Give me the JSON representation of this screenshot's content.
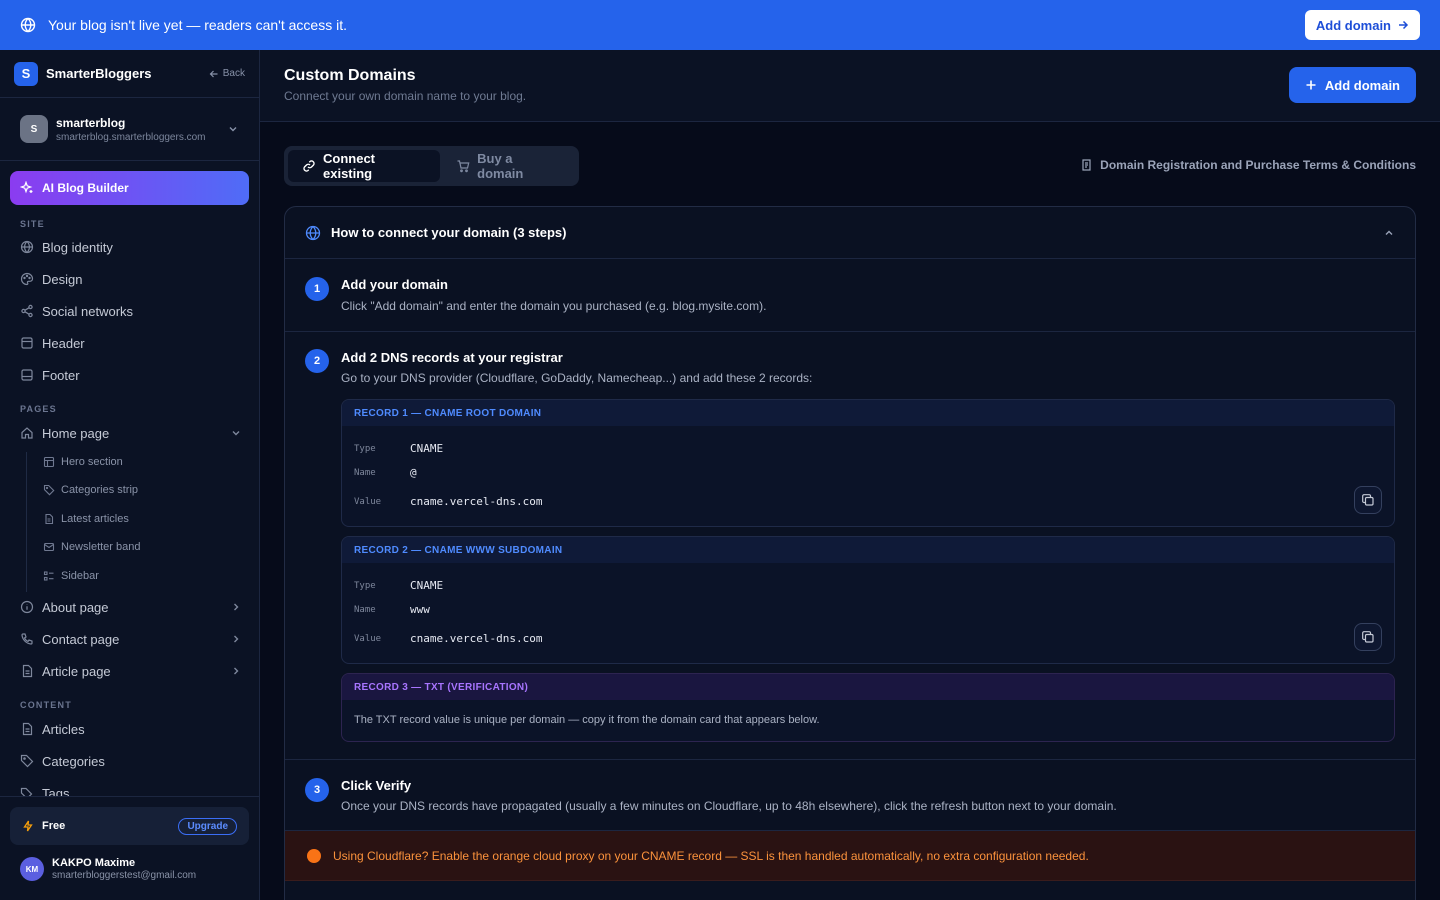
{
  "banner": {
    "message": "Your blog isn't live yet — readers can't access it.",
    "button_label": "Add domain",
    "color": "#2563eb"
  },
  "sidebar": {
    "brand_initial": "S",
    "brand_name": "SmarterBloggers",
    "back_label": "Back",
    "blog": {
      "initial": "S",
      "name": "smarterblog",
      "url": "smarterblog.smarterbloggers.com"
    },
    "ai_button": "AI Blog Builder",
    "sections": {
      "site": "SITE",
      "pages": "PAGES",
      "content": "CONTENT"
    },
    "site_items": [
      "Blog identity",
      "Design",
      "Social networks",
      "Header",
      "Footer"
    ],
    "pages_items": {
      "home": "Home page",
      "home_sub": [
        "Hero section",
        "Categories strip",
        "Latest articles",
        "Newsletter band",
        "Sidebar"
      ],
      "about": "About page",
      "contact": "Contact page",
      "article": "Article page"
    },
    "content_items": [
      "Articles",
      "Categories",
      "Tags"
    ],
    "plan": {
      "name": "Free",
      "upgrade": "Upgrade"
    },
    "user": {
      "initials": "KM",
      "name": "KAKPO Maxime",
      "email": "smarterbloggerstest@gmail.com"
    }
  },
  "main": {
    "title": "Custom Domains",
    "subtitle": "Connect your own domain name to your blog.",
    "add_button": "Add domain",
    "tabs": [
      "Connect existing",
      "Buy a domain"
    ],
    "terms_link": "Domain Registration and Purchase Terms & Conditions",
    "guide": {
      "title": "How to connect your domain (3 steps)",
      "steps": [
        {
          "num": "1",
          "title": "Add your domain",
          "desc": "Click \"Add domain\" and enter the domain you purchased (e.g. blog.mysite.com)."
        },
        {
          "num": "2",
          "title": "Add 2 DNS records at your registrar",
          "desc": "Go to your DNS provider (Cloudflare, GoDaddy, Namecheap...) and add these 2 records:"
        },
        {
          "num": "3",
          "title": "Click Verify",
          "desc": "Once your DNS records have propagated (usually a few minutes on Cloudflare, up to 48h elsewhere), click the refresh button next to your domain."
        }
      ],
      "records": [
        {
          "header": "RECORD 1 — CNAME ROOT DOMAIN",
          "type_key": "Type",
          "type": "CNAME",
          "name_key": "Name",
          "name": "@",
          "value_key": "Value",
          "value": "cname.vercel-dns.com"
        },
        {
          "header": "RECORD 2 — CNAME WWW SUBDOMAIN",
          "type_key": "Type",
          "type": "CNAME",
          "name_key": "Name",
          "name": "www",
          "value_key": "Value",
          "value": "cname.vercel-dns.com"
        }
      ],
      "txt_record": {
        "header": "RECORD 3 — TXT (VERIFICATION)",
        "note": "The TXT record value is unique per domain — copy it from the domain card that appears below."
      },
      "alert": "Using Cloudflare? Enable the orange cloud proxy on your CNAME record — SSL is then handled automatically, no extra configuration needed."
    }
  },
  "colors": {
    "accent": "#2563eb",
    "purple": "#a875ff",
    "warning": "#fb923c",
    "background": "#060b1a"
  }
}
